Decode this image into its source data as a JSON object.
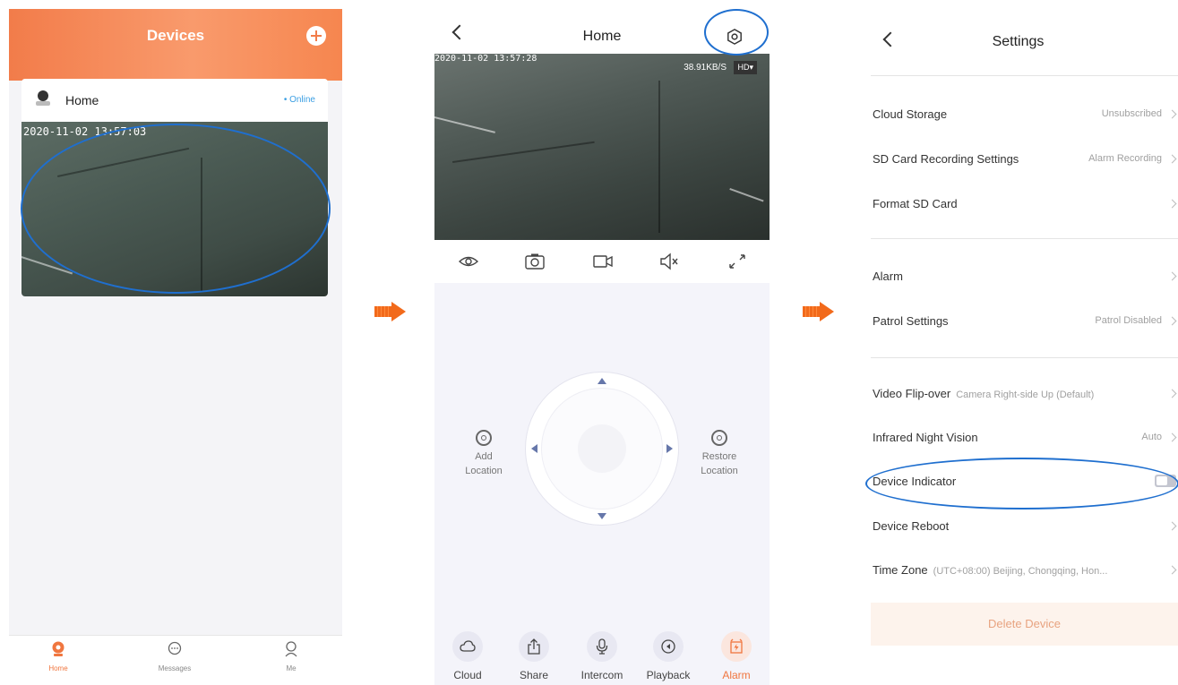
{
  "screen1": {
    "title": "Devices",
    "device": {
      "name": "Home",
      "status": "• Online",
      "timestamp": "2020-11-02 13:57:03"
    },
    "tabs": [
      {
        "label": "Home",
        "icon": "camera-home-icon",
        "active": true
      },
      {
        "label": "Messages",
        "icon": "messages-icon",
        "active": false
      },
      {
        "label": "Me",
        "icon": "profile-icon",
        "active": false
      }
    ]
  },
  "screen2": {
    "title": "Home",
    "timestamp": "2020-11-02 13:57:28",
    "bitrate": "38.91KB/S",
    "quality": "HD▾",
    "tools": [
      "eye-icon",
      "snapshot-icon",
      "record-icon",
      "mute-icon",
      "fullscreen-icon"
    ],
    "add_location": [
      "Add",
      "Location"
    ],
    "restore_location": [
      "Restore",
      "Location"
    ],
    "buttons": [
      "Cloud",
      "Share",
      "Intercom",
      "Playback",
      "Alarm"
    ]
  },
  "screen3": {
    "title": "Settings",
    "items": [
      {
        "label": "Cloud Storage",
        "value": "Unsubscribed"
      },
      {
        "label": "SD Card Recording Settings",
        "value": "Alarm Recording"
      },
      {
        "label": "Format SD Card",
        "value": ""
      },
      {
        "label": "Alarm",
        "value": ""
      },
      {
        "label": "Patrol Settings",
        "value": "Patrol Disabled"
      },
      {
        "label": "Video Flip-over",
        "value": "Camera Right-side Up (Default)"
      },
      {
        "label": "Infrared Night Vision",
        "value": "Auto"
      },
      {
        "label": "Device Indicator",
        "value": "",
        "toggle": false
      },
      {
        "label": "Device Reboot",
        "value": ""
      },
      {
        "label": "Time Zone",
        "value": "(UTC+08:00) Beijing, Chongqing, Hon..."
      }
    ],
    "delete_label": "Delete Device"
  },
  "colors": {
    "accent": "#f0763f",
    "highlight": "#1f6fcf",
    "online": "#3b9fe3"
  }
}
